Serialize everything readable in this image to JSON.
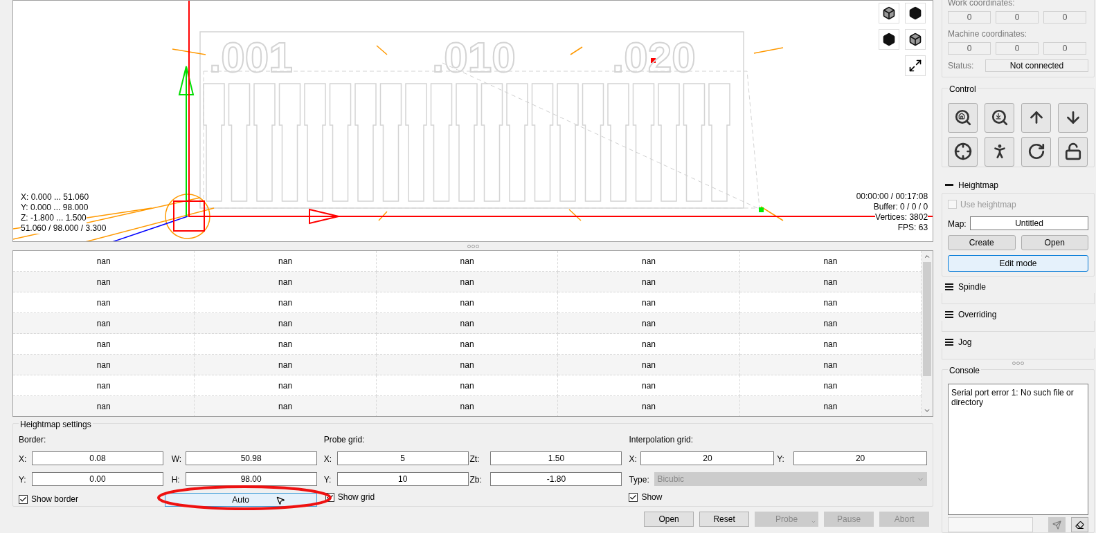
{
  "viewport": {
    "toolpath_labels": [
      ".001",
      ".010",
      ".020"
    ],
    "bounds": [
      "X: 0.000 ... 51.060",
      "Y: 0.000 ... 98.000",
      "Z: -1.800 ... 1.500",
      "51.060 / 98.000 / 3.300"
    ],
    "stats": [
      "00:00:00 / 00:17:08",
      "Buffer: 0 / 0 / 0",
      "Vertices: 3802",
      "FPS: 63"
    ]
  },
  "table": {
    "rows": [
      [
        "nan",
        "nan",
        "nan",
        "nan",
        "nan"
      ],
      [
        "nan",
        "nan",
        "nan",
        "nan",
        "nan"
      ],
      [
        "nan",
        "nan",
        "nan",
        "nan",
        "nan"
      ],
      [
        "nan",
        "nan",
        "nan",
        "nan",
        "nan"
      ],
      [
        "nan",
        "nan",
        "nan",
        "nan",
        "nan"
      ],
      [
        "nan",
        "nan",
        "nan",
        "nan",
        "nan"
      ],
      [
        "nan",
        "nan",
        "nan",
        "nan",
        "nan"
      ],
      [
        "nan",
        "nan",
        "nan",
        "nan",
        "nan"
      ]
    ]
  },
  "heightmap_settings": {
    "title": "Heightmap settings",
    "border": {
      "label": "Border:",
      "fields": [
        {
          "label": "X:",
          "value": "0.08"
        },
        {
          "label": "W:",
          "value": "50.98"
        },
        {
          "label": "Y:",
          "value": "0.00"
        },
        {
          "label": "H:",
          "value": "98.00"
        }
      ],
      "show": {
        "label": "Show border",
        "checked": true
      },
      "auto_button": "Auto"
    },
    "probe_grid": {
      "label": "Probe grid:",
      "fields": [
        {
          "label": "X:",
          "value": "5"
        },
        {
          "label": "Zt:",
          "value": "1.50"
        },
        {
          "label": "Y:",
          "value": "10"
        },
        {
          "label": "Zb:",
          "value": "-1.80"
        }
      ],
      "show": {
        "label": "Show grid",
        "checked": true
      }
    },
    "interpolation_grid": {
      "label": "Interpolation grid:",
      "fields": [
        {
          "label": "X:",
          "value": "20"
        },
        {
          "label": "Y:",
          "value": "20"
        }
      ],
      "type": {
        "label": "Type:",
        "value": "Bicubic",
        "disabled": true
      },
      "show": {
        "label": "Show",
        "checked": true
      }
    }
  },
  "actions": [
    {
      "label": "Open",
      "disabled": false,
      "kind": "button"
    },
    {
      "label": "Reset",
      "disabled": false,
      "kind": "button"
    },
    {
      "label": "Probe",
      "disabled": true,
      "kind": "dropdown"
    },
    {
      "label": "Pause",
      "disabled": true,
      "kind": "button"
    },
    {
      "label": "Abort",
      "disabled": true,
      "kind": "button"
    }
  ],
  "state": {
    "work_label": "Work coordinates:",
    "work": [
      "0",
      "0",
      "0"
    ],
    "machine_label": "Machine coordinates:",
    "machine": [
      "0",
      "0",
      "0"
    ],
    "status_label": "Status:",
    "status": "Not connected"
  },
  "control": {
    "title": "Control"
  },
  "heightmap_panel": {
    "title": "Heightmap",
    "expanded": true,
    "use_heightmap": {
      "label": "Use heightmap",
      "checked": false,
      "disabled": true
    },
    "map_label": "Map:",
    "map_value": "Untitled",
    "buttons": [
      "Create",
      "Open"
    ],
    "edit_mode": "Edit mode"
  },
  "sections": [
    {
      "title": "Spindle",
      "expanded": false
    },
    {
      "title": "Overriding",
      "expanded": false
    },
    {
      "title": "Jog",
      "expanded": false
    }
  ],
  "console": {
    "title": "Console",
    "text": "Serial port error 1: No such file or directory"
  }
}
